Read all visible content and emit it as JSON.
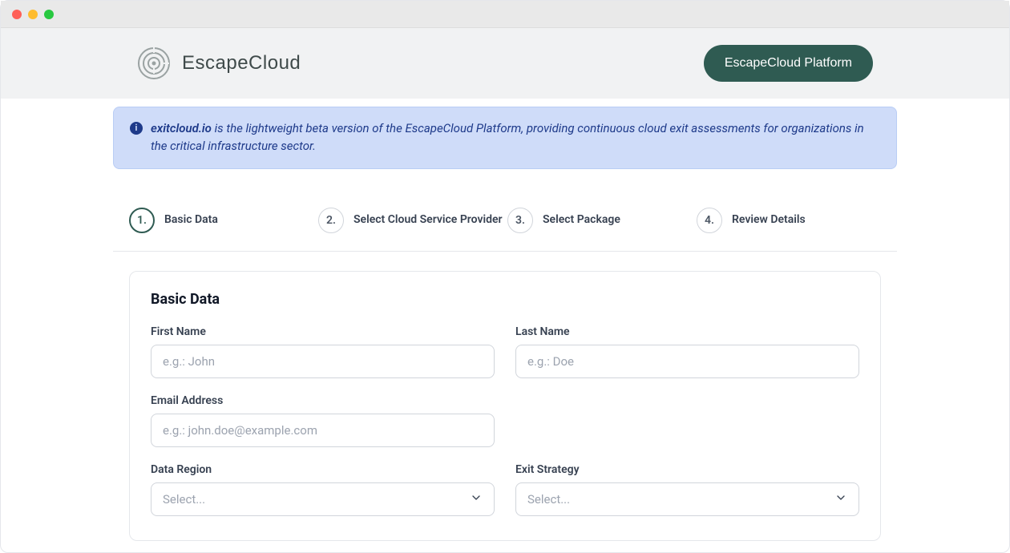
{
  "brand": {
    "name": "EscapeCloud"
  },
  "header": {
    "platform_button": "EscapeCloud Platform"
  },
  "banner": {
    "text_prefix": "exitcloud.io",
    "text_rest": " is the lightweight beta version of the EscapeCloud Platform, providing continuous cloud exit assessments for organizations in the critical infrastructure sector."
  },
  "stepper": {
    "s1": {
      "num": "1.",
      "label": "Basic Data"
    },
    "s2": {
      "num": "2.",
      "label": "Select Cloud Service Provider"
    },
    "s3": {
      "num": "3.",
      "label": "Select Package"
    },
    "s4": {
      "num": "4.",
      "label": "Review Details"
    }
  },
  "form": {
    "title": "Basic Data",
    "first_name": {
      "label": "First Name",
      "placeholder": "e.g.: John",
      "value": ""
    },
    "last_name": {
      "label": "Last Name",
      "placeholder": "e.g.: Doe",
      "value": ""
    },
    "email": {
      "label": "Email Address",
      "placeholder": "e.g.: john.doe@example.com",
      "value": ""
    },
    "data_region": {
      "label": "Data Region",
      "selected": "Select..."
    },
    "exit_strategy": {
      "label": "Exit Strategy",
      "selected": "Select..."
    }
  }
}
